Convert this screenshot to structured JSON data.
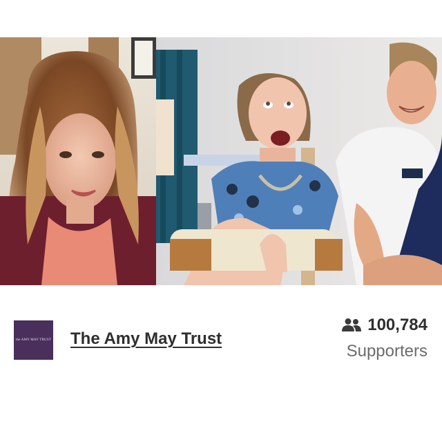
{
  "photos": {
    "left_alt": "Smiling woman with long wavy hair",
    "right_alt": "Young woman in a standing frame laughing with physiotherapists"
  },
  "organisation": {
    "logo_text": "the AMY MAY TRUST",
    "name": "The Amy May Trust",
    "brand_color": "#4a2e5c"
  },
  "supporters": {
    "icon": "people-icon",
    "count": "100,784",
    "label": "Supporters"
  }
}
